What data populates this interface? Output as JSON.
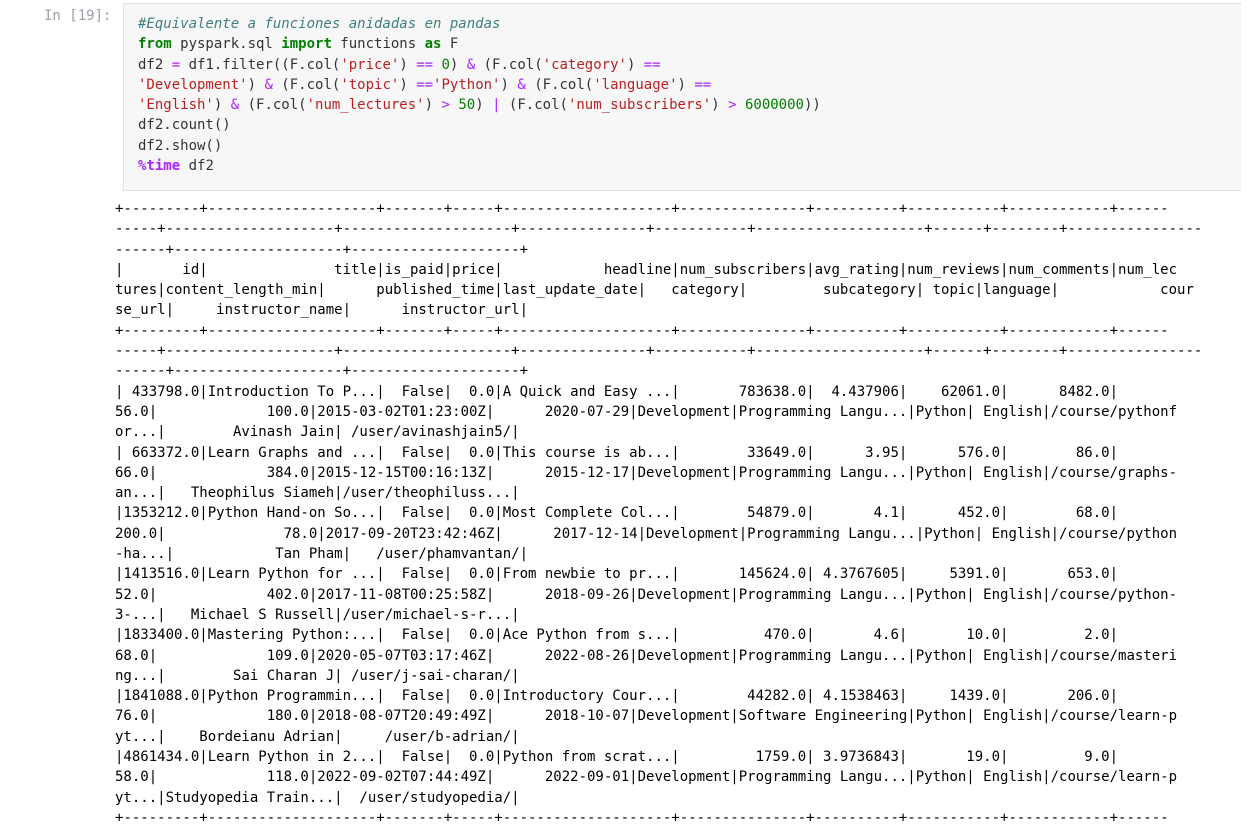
{
  "cell": {
    "prompt": "In [19]:",
    "code_comment": "#Equivalente a funciones anidadas en pandas",
    "code": {
      "kw_from": "from",
      "mod": " pyspark.sql ",
      "kw_import": "import",
      "name1": " functions ",
      "kw_as": "as",
      "alias": " F",
      "l2_a": "df2 ",
      "op_eq": "=",
      "l2_b": " df1.filter((F.col(",
      "s_price": "'price'",
      "l2_c": ") ",
      "op_eqeq": "==",
      "n_zero": " 0",
      "l2_d": ") ",
      "op_and": "&",
      "l2_e": " (F.col(",
      "s_category": "'category'",
      "l2_f": ") ",
      "s_development": "'Development'",
      "l3_a": ") ",
      "l3_b": " (F.col(",
      "s_topic": "'topic'",
      "l3_c": ") ",
      "s_python": "'Python'",
      "l3_d": ") ",
      "l3_e": " (F.col(",
      "s_language": "'language'",
      "l3_f": ") ",
      "s_english": "'English'",
      "l4_a": ") ",
      "l4_b": " (F.col(",
      "s_num_lectures": "'num_lectures'",
      "l4_c": ") ",
      "op_gt": ">",
      "n_50": " 50",
      "l4_d": ") ",
      "op_or": "|",
      "l4_e": " (F.col(",
      "s_num_subscribers": "'num_subscribers'",
      "l4_f": ") ",
      "n_6000000": " 6000000",
      "l4_g": "))",
      "line5": "df2.count()",
      "line6": "df2.show()",
      "magic": "%time",
      "line7_rest": " df2"
    },
    "output": [
      "+---------+--------------------+-------+-----+--------------------+---------------+----------+-----------+------------+------",
      "-----+--------------------+--------------------+---------------+-----------+--------------------+------+--------+----------------",
      "------+--------------------+--------------------+",
      "|       id|               title|is_paid|price|            headline|num_subscribers|avg_rating|num_reviews|num_comments|num_lec",
      "tures|content_length_min|      published_time|last_update_date|   category|         subcategory| topic|language|            cour",
      "se_url|     instructor_name|      instructor_url|",
      "+---------+--------------------+-------+-----+--------------------+---------------+----------+-----------+------------+------",
      "-----+--------------------+--------------------+---------------+-----------+--------------------+------+--------+----------------",
      "------+--------------------+--------------------+",
      "| 433798.0|Introduction To P...|  False|  0.0|A Quick and Easy ...|       783638.0|  4.437906|    62061.0|      8482.0|",
      "56.0|             100.0|2015-03-02T01:23:00Z|      2020-07-29|Development|Programming Langu...|Python| English|/course/pythonf",
      "or...|        Avinash Jain| /user/avinashjain5/|",
      "| 663372.0|Learn Graphs and ...|  False|  0.0|This course is ab...|        33649.0|      3.95|      576.0|        86.0|",
      "66.0|             384.0|2015-12-15T00:16:13Z|      2015-12-17|Development|Programming Langu...|Python| English|/course/graphs-",
      "an...|   Theophilus Siameh|/user/theophiluss...|",
      "|1353212.0|Python Hand-on So...|  False|  0.0|Most Complete Col...|        54879.0|       4.1|      452.0|        68.0|",
      "200.0|              78.0|2017-09-20T23:42:46Z|      2017-12-14|Development|Programming Langu...|Python| English|/course/python",
      "-ha...|            Tan Pham|   /user/phamvantan/|",
      "|1413516.0|Learn Python for ...|  False|  0.0|From newbie to pr...|       145624.0| 4.3767605|     5391.0|       653.0|",
      "52.0|             402.0|2017-11-08T00:25:58Z|      2018-09-26|Development|Programming Langu...|Python| English|/course/python-",
      "3-...|   Michael S Russell|/user/michael-s-r...|",
      "|1833400.0|Mastering Python:...|  False|  0.0|Ace Python from s...|          470.0|       4.6|       10.0|         2.0|",
      "68.0|             109.0|2020-05-07T03:17:46Z|      2022-08-26|Development|Programming Langu...|Python| English|/course/masteri",
      "ng...|        Sai Charan J| /user/j-sai-charan/|",
      "|1841088.0|Python Programmin...|  False|  0.0|Introductory Cour...|        44282.0| 4.1538463|     1439.0|       206.0|",
      "76.0|             180.0|2018-08-07T20:49:49Z|      2018-10-07|Development|Software Engineering|Python| English|/course/learn-p",
      "yt...|    Bordeianu Adrian|     /user/b-adrian/|",
      "|4861434.0|Learn Python in 2...|  False|  0.0|Python from scrat...|         1759.0| 3.9736843|       19.0|         9.0|",
      "58.0|             118.0|2022-09-02T07:44:49Z|      2022-09-01|Development|Programming Langu...|Python| English|/course/learn-p",
      "yt...|Studyopedia Train...|  /user/studyopedia/|",
      "+---------+--------------------+-------+-----+--------------------+---------------+----------+-----------+------------+------"
    ]
  }
}
